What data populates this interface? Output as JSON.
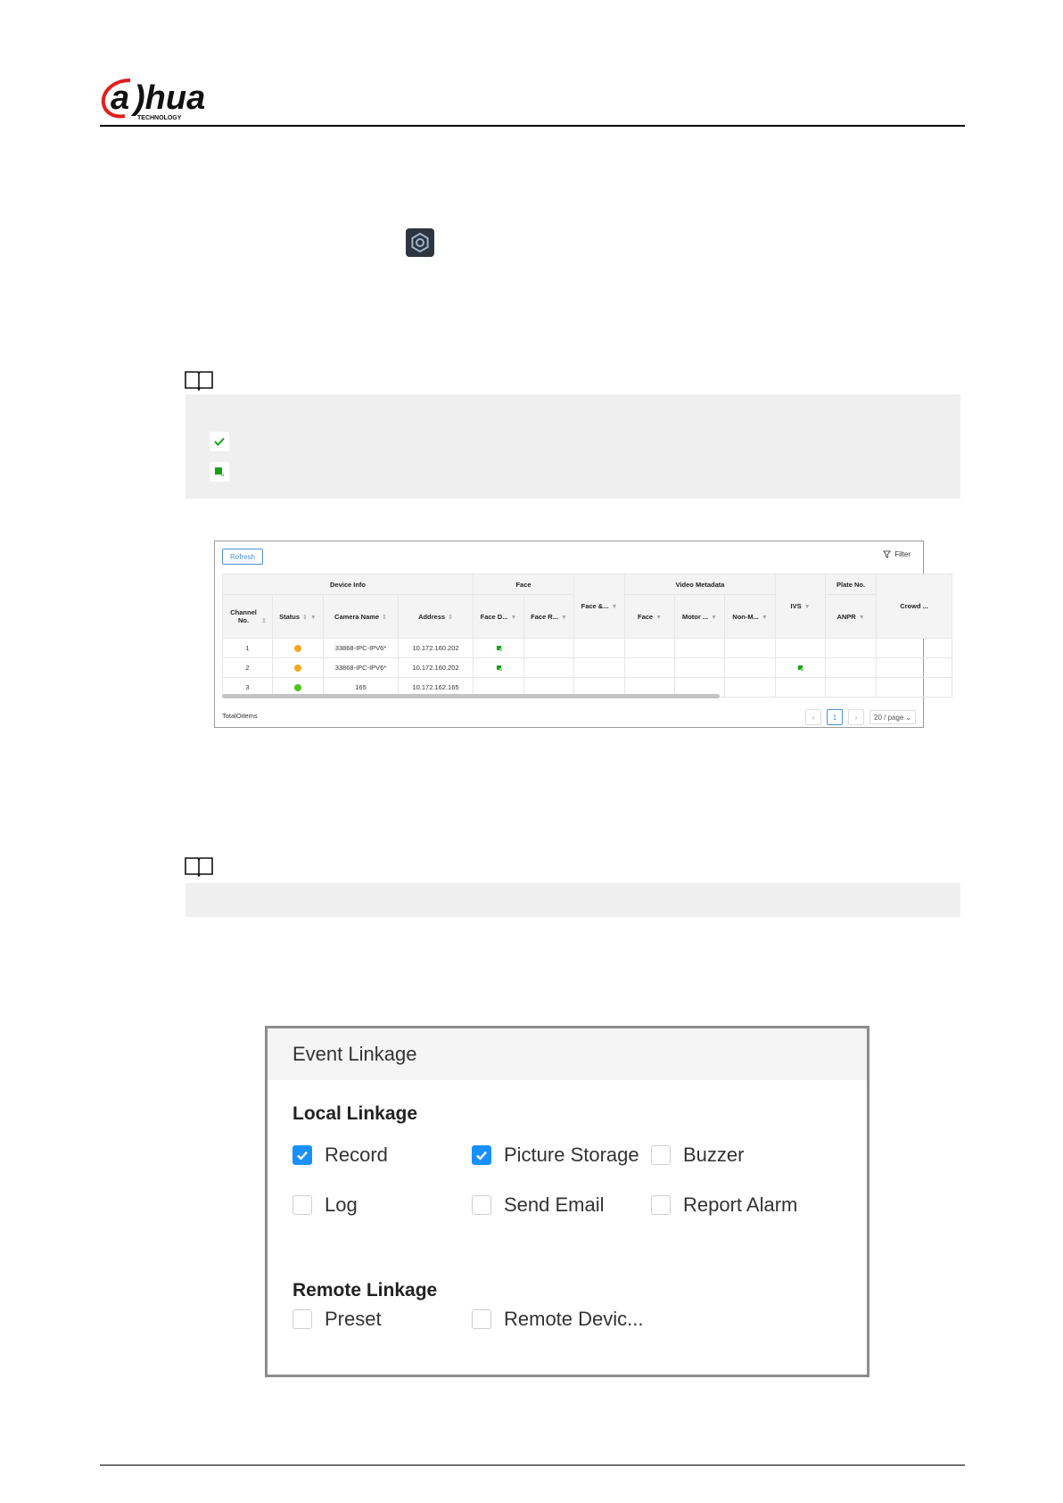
{
  "header": {
    "logo_text": "alhua",
    "logo_sub": "TECHNOLOGY"
  },
  "notes": [
    {
      "icon": "book-icon",
      "items": [
        {
          "icon": "green-check-icon"
        },
        {
          "icon": "green-square-icon"
        }
      ]
    },
    {
      "icon": "book-icon"
    }
  ],
  "device_table": {
    "refresh_label": "Refresh",
    "filter_label": "Filter",
    "group_headers": [
      "Device Info",
      "Face",
      "Video Metadata",
      "Plate No."
    ],
    "columns": [
      "Channel No.",
      "Status",
      "Camera Name",
      "Address",
      "Face D...",
      "Face R...",
      "Face &...",
      "Face",
      "Motor ...",
      "Non-M...",
      "IVS",
      "ANPR",
      "Crowd ..."
    ],
    "rows": [
      {
        "channel": "1",
        "status": "offline",
        "camera": "33868-IPC-IPV6*",
        "address": "10.172.160.202",
        "face_d": true,
        "ivs": false
      },
      {
        "channel": "2",
        "status": "offline",
        "camera": "33868-IPC-IPV6*",
        "address": "10.172.160.202",
        "face_d": true,
        "ivs": true
      },
      {
        "channel": "3",
        "status": "online",
        "camera": "165",
        "address": "10.172.162.165",
        "face_d": false,
        "ivs": false
      }
    ],
    "status_colors": {
      "offline": "#f5a623",
      "online": "#52c41a"
    },
    "total_label": "TotalOitems",
    "page_current": "1",
    "page_size": "20 / page"
  },
  "event_linkage": {
    "title": "Event Linkage",
    "local_title": "Local Linkage",
    "local_options": [
      {
        "label": "Record",
        "checked": true
      },
      {
        "label": "Picture Storage",
        "checked": true
      },
      {
        "label": "Buzzer",
        "checked": false
      },
      {
        "label": "Log",
        "checked": false
      },
      {
        "label": "Send Email",
        "checked": false
      },
      {
        "label": "Report Alarm",
        "checked": false
      }
    ],
    "remote_title": "Remote Linkage",
    "remote_options": [
      {
        "label": "Preset",
        "checked": false
      },
      {
        "label": "Remote Devic...",
        "checked": false
      }
    ],
    "accent_color": "#1890ff"
  }
}
